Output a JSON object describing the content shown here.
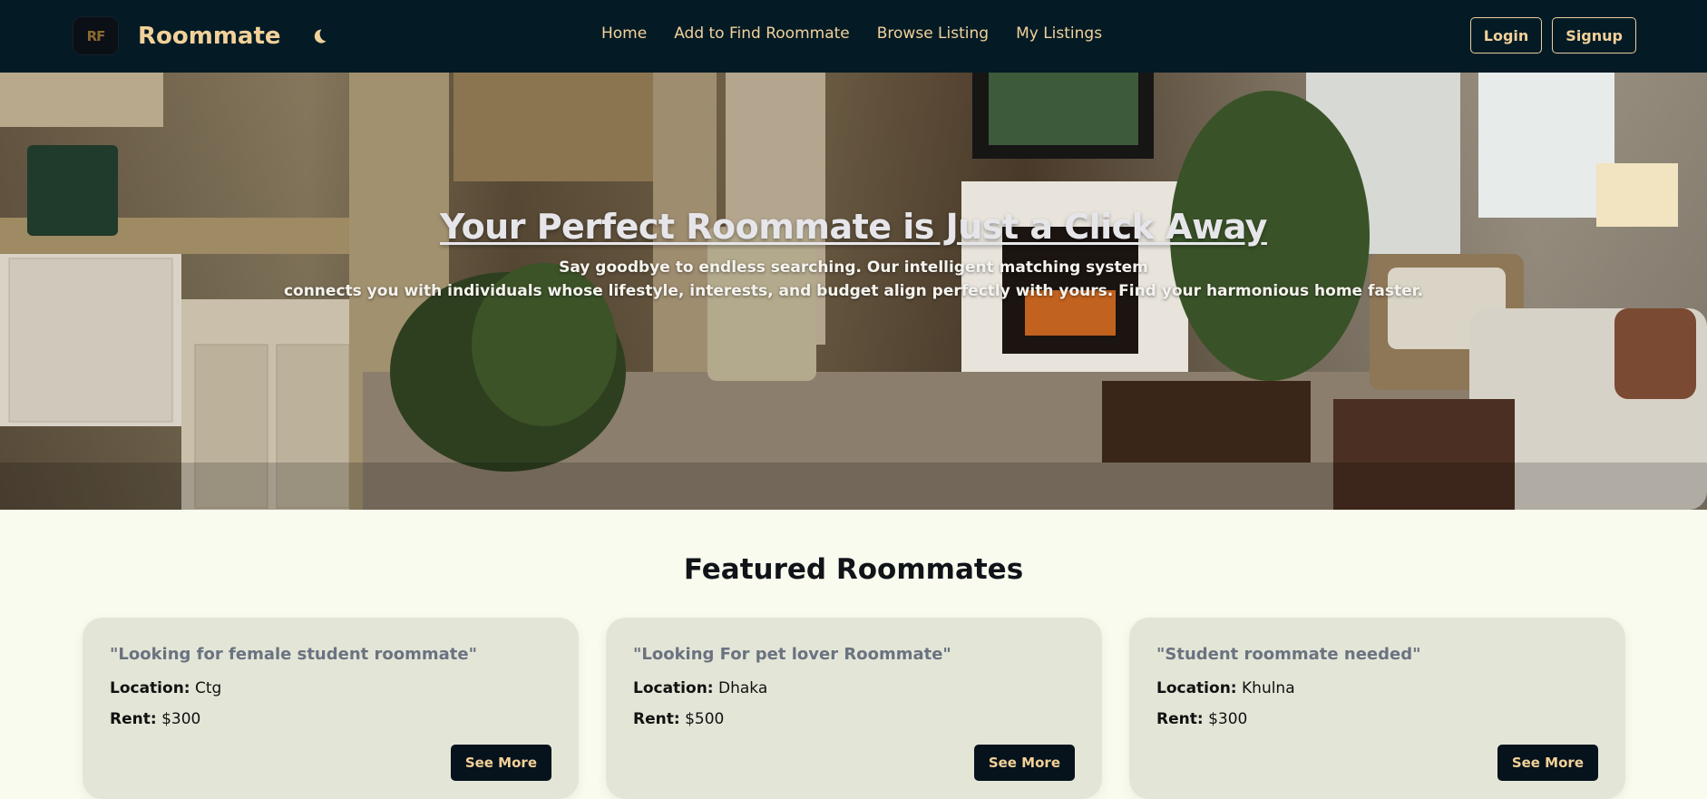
{
  "nav": {
    "logo_text": "RF",
    "brand": "Roommate",
    "links": [
      "Home",
      "Add to Find Roommate",
      "Browse Listing",
      "My Listings"
    ],
    "login": "Login",
    "signup": "Signup"
  },
  "hero": {
    "title": "Your Perfect Roommate is Just a Click Away",
    "subtitle_line1": "Say goodbye to endless searching. Our intelligent matching system",
    "subtitle_line2": "connects you with individuals whose lifestyle, interests, and budget align perfectly with yours. Find your harmonious home faster."
  },
  "featured": {
    "title": "Featured Roommates",
    "location_label": "Location:",
    "rent_label": "Rent:",
    "button": "See More",
    "cards": [
      {
        "title": "\"Looking for female student roommate\"",
        "location": "Ctg",
        "rent": "$300"
      },
      {
        "title": "\"Looking For pet lover Roommate\"",
        "location": "Dhaka",
        "rent": "$500"
      },
      {
        "title": "\"Student roommate needed\"",
        "location": "Khulna",
        "rent": "$300"
      }
    ]
  },
  "colors": {
    "navbar": "#041b26",
    "accent": "#f2d199",
    "page_bg": "#f8fbee",
    "card_bg": "#e3e6d7",
    "button_bg": "#06121c"
  },
  "icons": {
    "theme_toggle": "moon-icon"
  }
}
